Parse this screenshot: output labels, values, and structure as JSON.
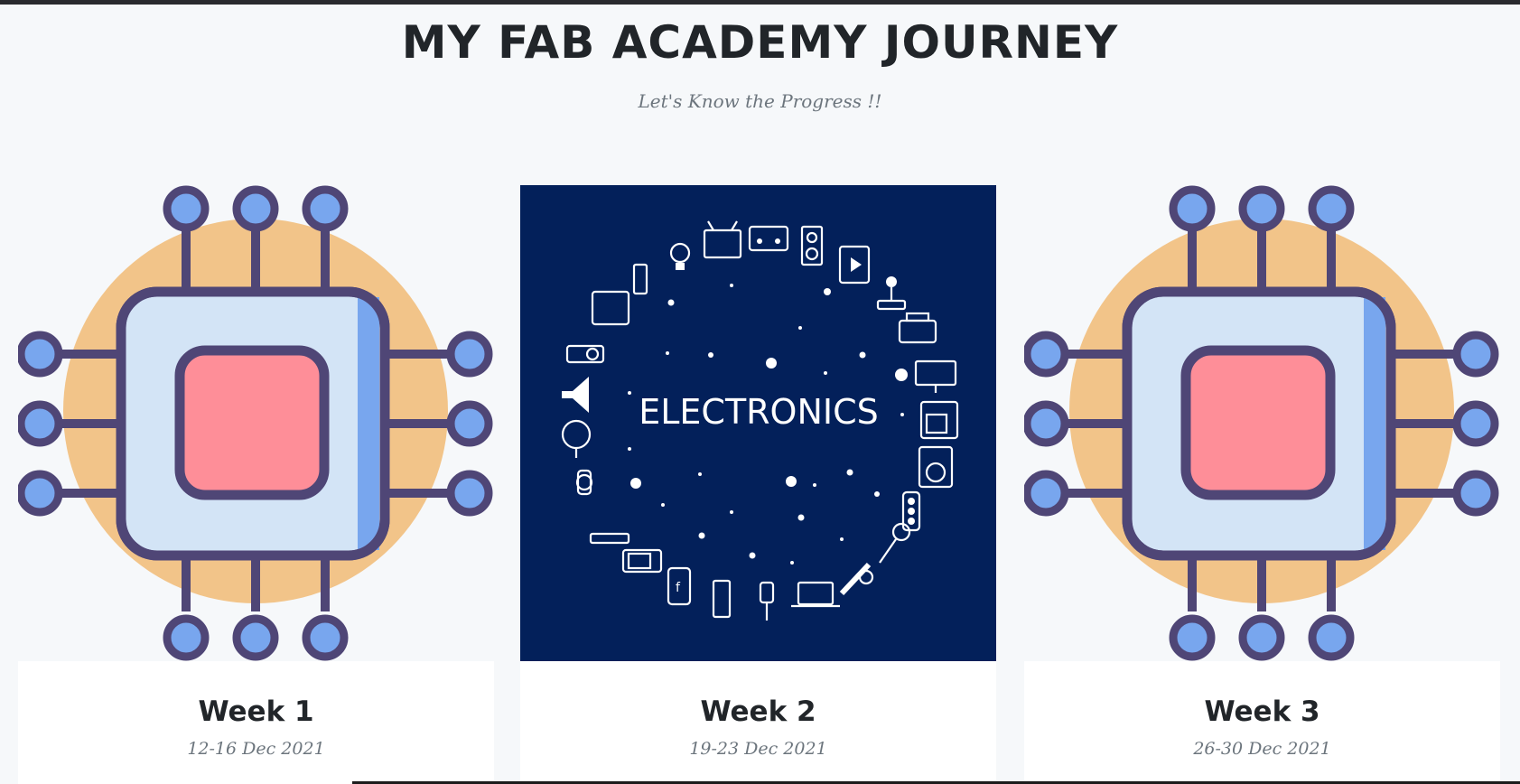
{
  "page": {
    "title": "MY FAB ACADEMY JOURNEY",
    "subtitle": "Let's Know the Progress !!"
  },
  "colors": {
    "background": "#f6f8fa",
    "chip_body": "#d3e4f6",
    "chip_core": "#fe8e98",
    "chip_outline": "#4f4676",
    "chip_pin": "#78a6ee",
    "chip_halo": "#f2c489",
    "electronics_bg": "#03205a"
  },
  "cards": [
    {
      "week": "Week 1",
      "dates": "12-16 Dec 2021",
      "image": "microchip-icon"
    },
    {
      "week": "Week 2",
      "dates": "19-23 Dec 2021",
      "image": "electronics-banner",
      "image_text": "ELECTRONICS"
    },
    {
      "week": "Week 3",
      "dates": "26-30 Dec 2021",
      "image": "microchip-icon"
    }
  ]
}
